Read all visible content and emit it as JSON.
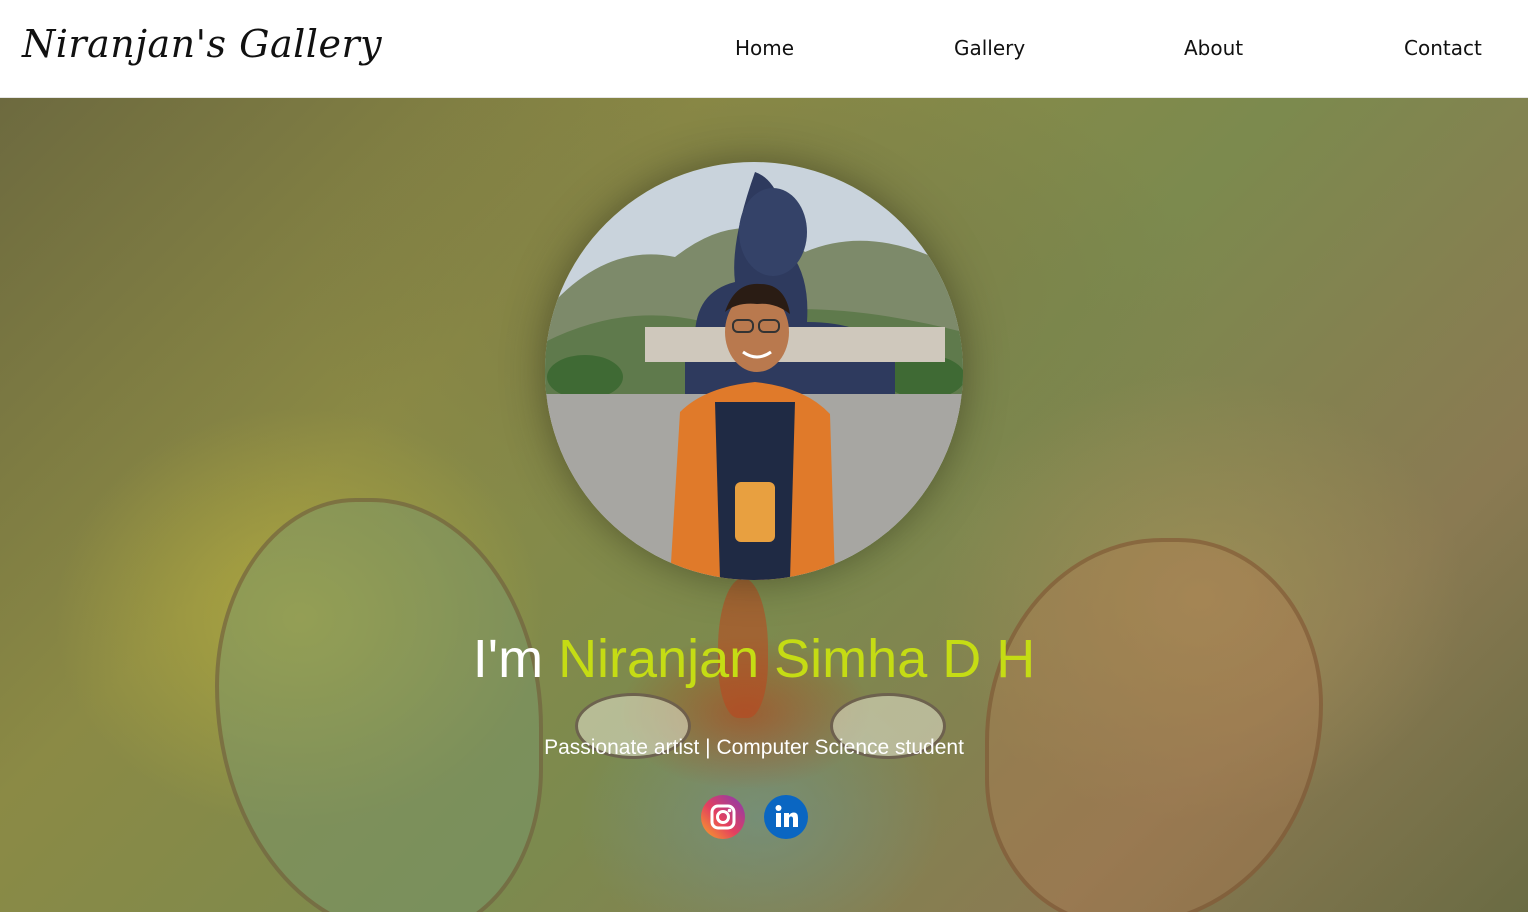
{
  "navbar": {
    "brand": "Niranjan's Gallery",
    "links": [
      "Home",
      "Gallery",
      "About",
      "Contact"
    ]
  },
  "hero": {
    "greeting_prefix": "I'm ",
    "name": "Niranjan Simha D H",
    "tagline": "Passionate artist | Computer Science student",
    "name_color": "#c5dc14",
    "social": [
      {
        "icon": "instagram-icon"
      },
      {
        "icon": "linkedin-icon"
      }
    ]
  }
}
